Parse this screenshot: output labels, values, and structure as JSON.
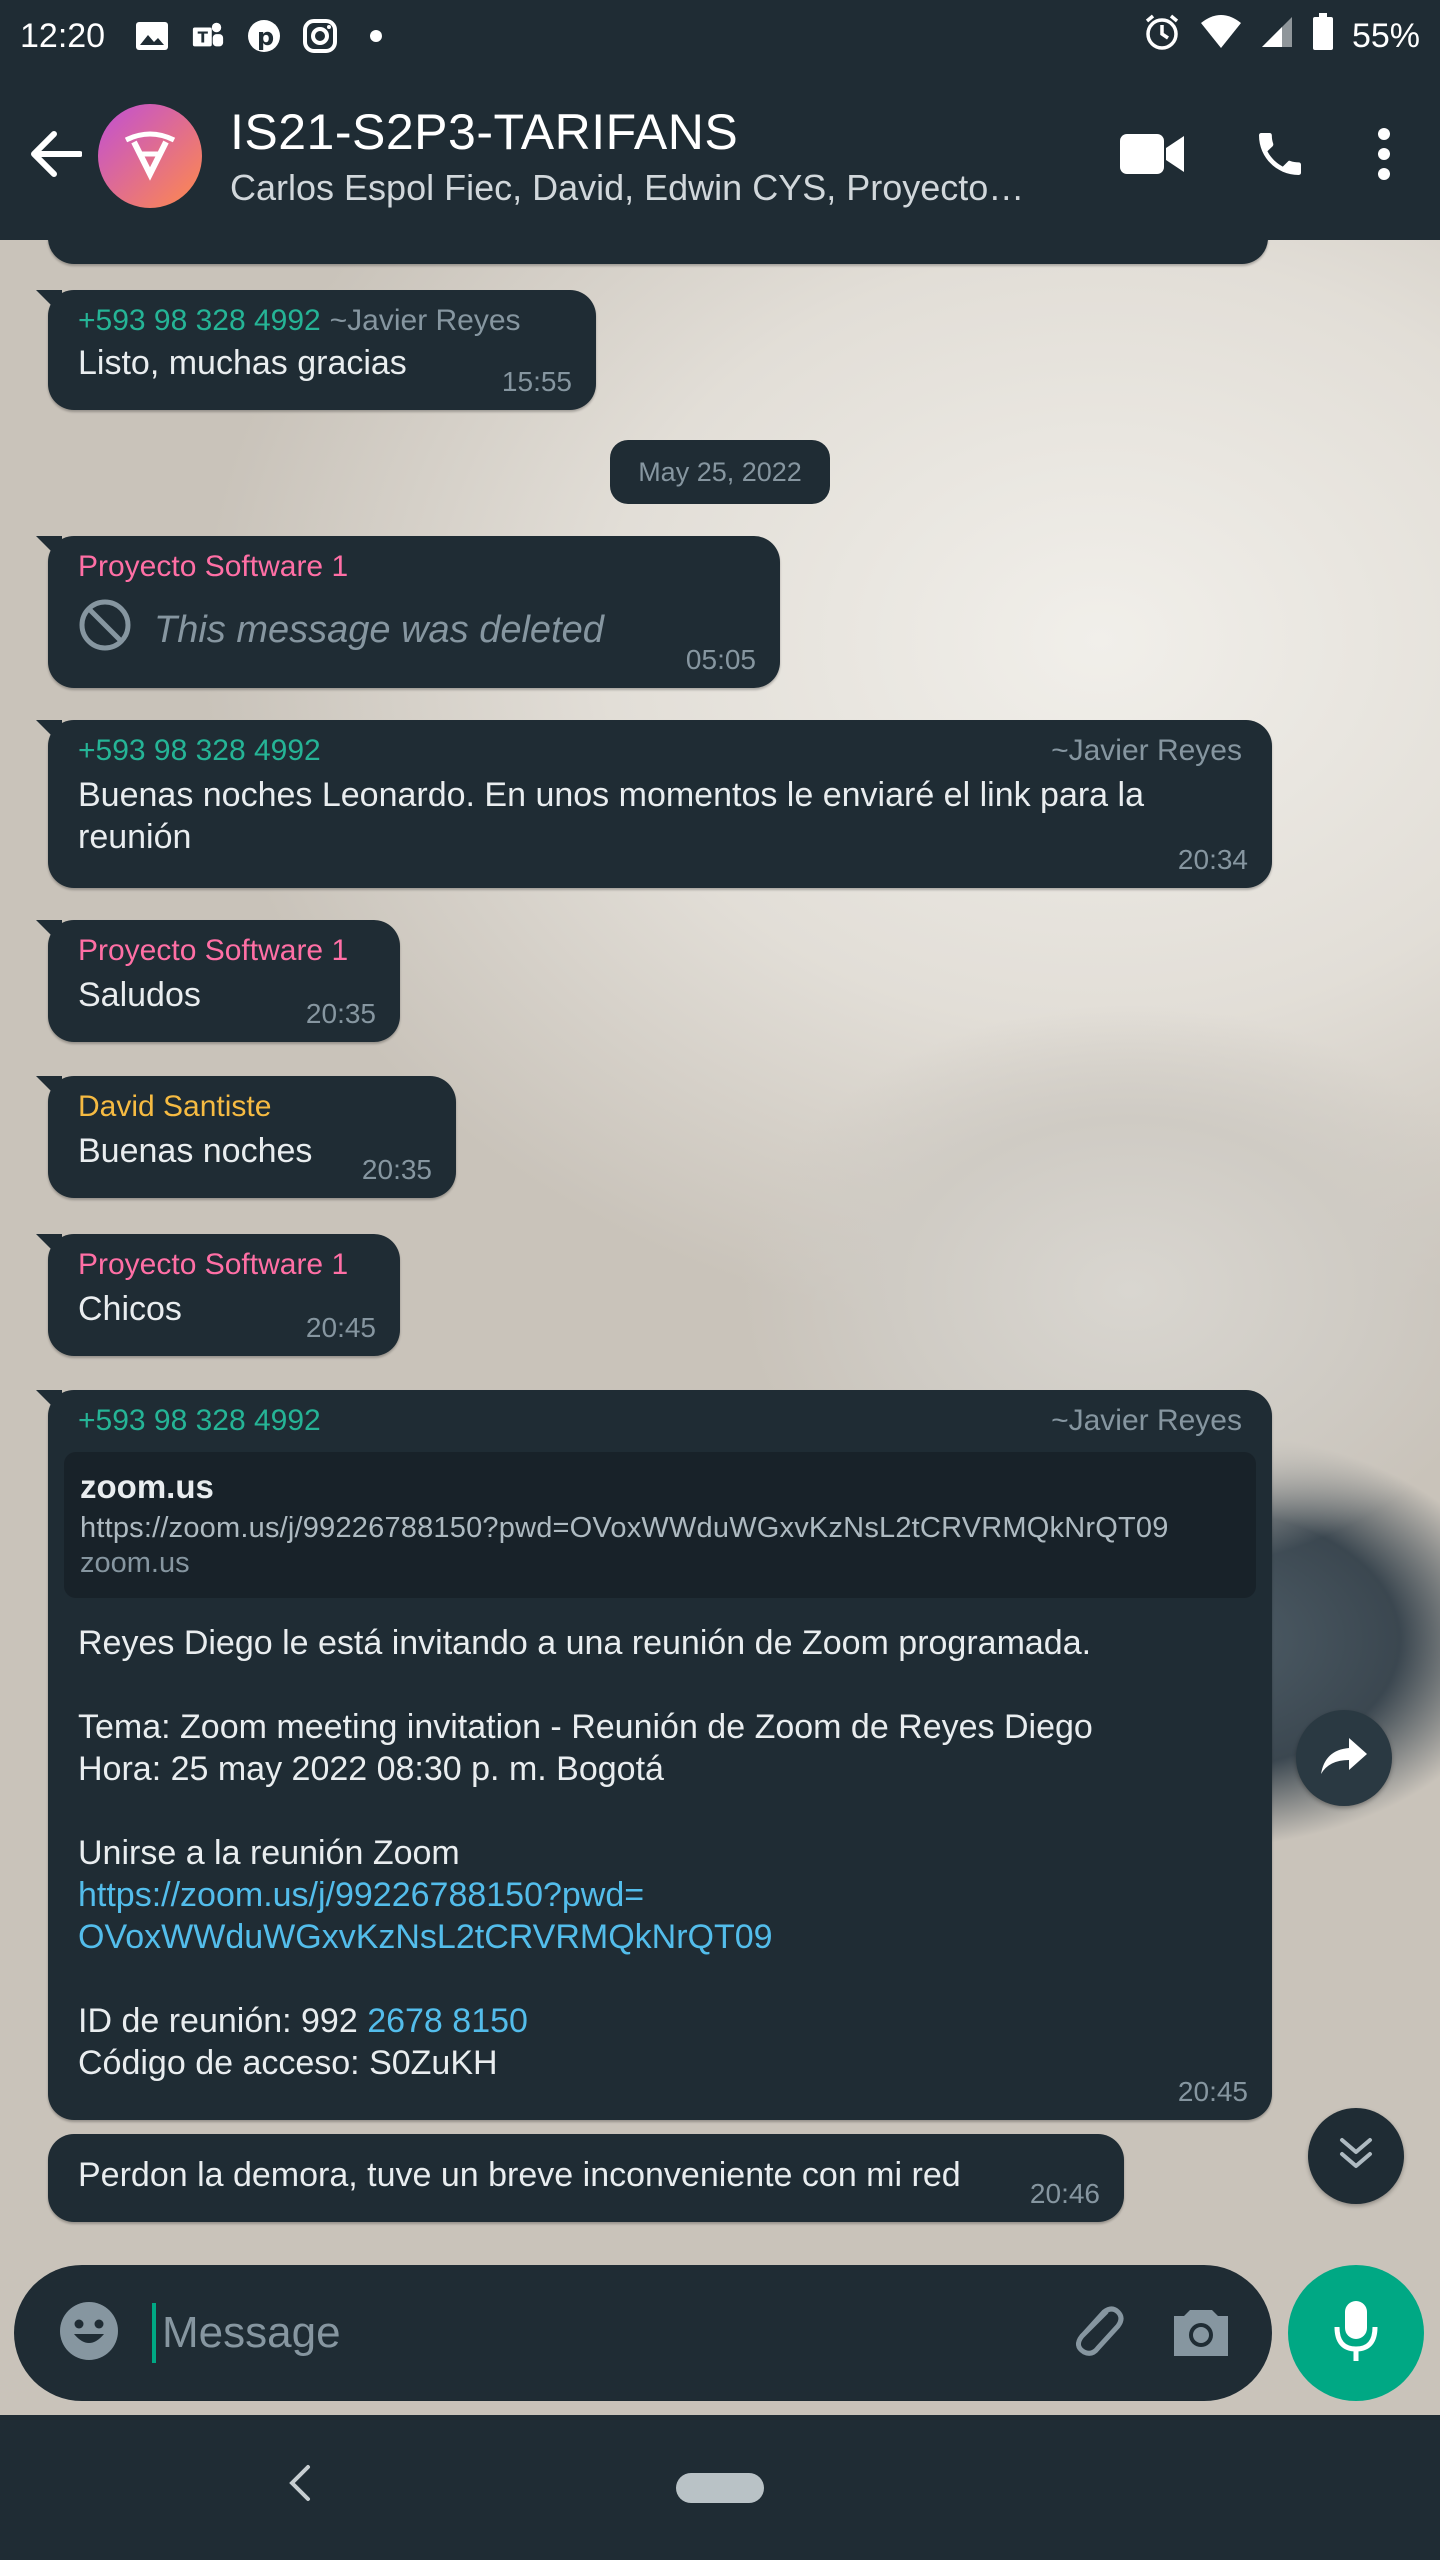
{
  "status_bar": {
    "time": "12:20",
    "battery": "55%"
  },
  "header": {
    "title": "IS21-S2P3-TARIFANS",
    "subtitle": "Carlos Espol Fiec, David, Edwin CYS, Proyecto…"
  },
  "date_chip": "May 25, 2022",
  "messages": [
    {
      "sender": "+593 98 328 4992",
      "alias": "~Javier Reyes",
      "text": "Listo, muchas gracias",
      "time": "15:55"
    },
    {
      "sender": "Proyecto Software 1",
      "text": "This message was deleted",
      "time": "05:05"
    },
    {
      "sender": "+593 98 328 4992",
      "alias": "~Javier Reyes",
      "text": "Buenas noches Leonardo. En unos momentos le enviaré el link para la reunión",
      "time": "20:34"
    },
    {
      "sender": "Proyecto Software 1",
      "text": "Saludos",
      "time": "20:35"
    },
    {
      "sender": "David Santiste",
      "text": "Buenas noches",
      "time": "20:35"
    },
    {
      "sender": "Proyecto Software 1",
      "text": "Chicos",
      "time": "20:45"
    },
    {
      "sender": "+593 98 328 4992",
      "alias": "~Javier Reyes",
      "preview": {
        "domain": "zoom.us",
        "url": "https://zoom.us/j/99226788150?pwd=OVoxWWduWGxvKzNsL2tCRVRMQkNrQT09",
        "source": "zoom.us"
      },
      "line1": "Reyes Diego le está invitando a una reunión de Zoom programada.",
      "line2": "Tema: Zoom meeting invitation - Reunión de Zoom de Reyes Diego",
      "line3": "Hora: 25 may 2022 08:30 p. m. Bogotá",
      "line4": "Unirse a la reunión Zoom",
      "link_a": "https://zoom.us/j/99226788150?pwd=",
      "link_b": "OVoxWWduWGxvKzNsL2tCRVRMQkNrQT09",
      "id_prefix": "ID de reunión: 992 ",
      "id_link": "2678 8150",
      "code": "Código de acceso: S0ZuKH",
      "time": "20:45"
    },
    {
      "text": "Perdon la demora, tuve un breve inconveniente con mi red",
      "time": "20:46"
    }
  ],
  "composer": {
    "placeholder": "Message"
  },
  "colors": {
    "accent": "#00a884",
    "bubble": "#1f2c34",
    "bar": "#1f2c34"
  },
  "icons": [
    "back-arrow-icon",
    "video-call-icon",
    "phone-icon",
    "more-vert-icon",
    "emoji-icon",
    "attach-icon",
    "camera-icon",
    "mic-icon",
    "forward-icon",
    "scroll-down-icon",
    "deleted-icon"
  ]
}
